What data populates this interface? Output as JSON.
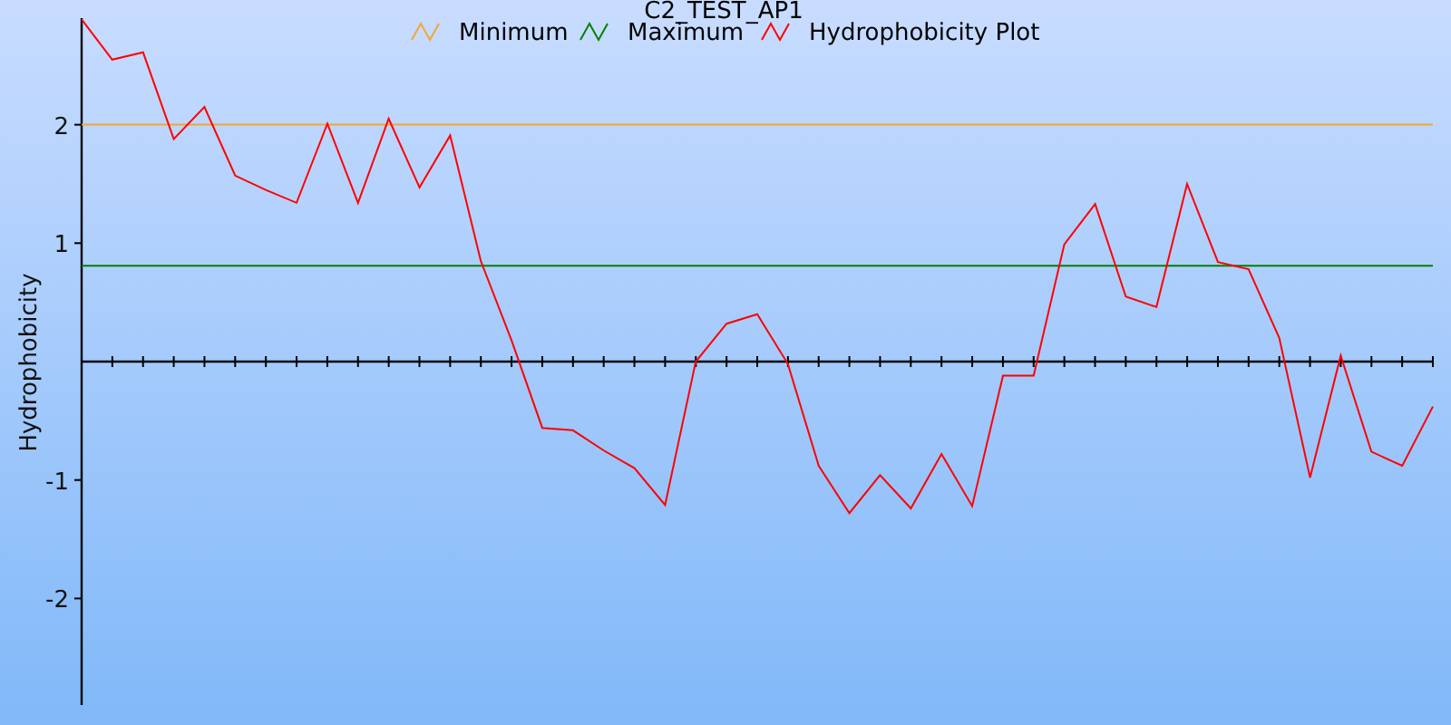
{
  "chart_data": {
    "type": "line",
    "title": "C2_TEST_AP1",
    "ylabel": "Hydrophobicity",
    "ylim": [
      -2.9,
      2.9
    ],
    "yticks": [
      -2,
      -1,
      1,
      2
    ],
    "legend": true,
    "series": [
      {
        "name": "Minimum",
        "color": "#f0a830",
        "values": [
          2,
          2,
          2,
          2,
          2,
          2,
          2,
          2,
          2,
          2,
          2,
          2,
          2,
          2,
          2,
          2,
          2,
          2,
          2,
          2,
          2,
          2,
          2,
          2,
          2,
          2,
          2,
          2,
          2,
          2,
          2,
          2,
          2,
          2,
          2,
          2,
          2,
          2,
          2,
          2,
          2,
          2,
          2,
          2,
          2
        ]
      },
      {
        "name": "Maximum",
        "color": "#008000",
        "values": [
          0.81,
          0.81,
          0.81,
          0.81,
          0.81,
          0.81,
          0.81,
          0.81,
          0.81,
          0.81,
          0.81,
          0.81,
          0.81,
          0.81,
          0.81,
          0.81,
          0.81,
          0.81,
          0.81,
          0.81,
          0.81,
          0.81,
          0.81,
          0.81,
          0.81,
          0.81,
          0.81,
          0.81,
          0.81,
          0.81,
          0.81,
          0.81,
          0.81,
          0.81,
          0.81,
          0.81,
          0.81,
          0.81,
          0.81,
          0.81,
          0.81,
          0.81,
          0.81,
          0.81,
          0.81
        ]
      },
      {
        "name": "Hydrophobicity Plot",
        "color": "#ff0000",
        "values": [
          2.89,
          2.55,
          2.61,
          1.88,
          2.15,
          1.57,
          1.45,
          1.34,
          2.01,
          1.34,
          2.05,
          1.47,
          1.91,
          0.85,
          0.18,
          -0.56,
          -0.58,
          -0.75,
          -0.9,
          -1.21,
          0,
          0.32,
          0.4,
          -0.02,
          -0.88,
          -1.28,
          -0.96,
          -1.24,
          -0.78,
          -1.22,
          -0.12,
          -0.12,
          0.99,
          1.33,
          0.55,
          0.46,
          1.5,
          0.84,
          0.78,
          0.2,
          -0.98,
          0.05,
          -0.76,
          -0.88,
          -0.38
        ]
      }
    ]
  }
}
